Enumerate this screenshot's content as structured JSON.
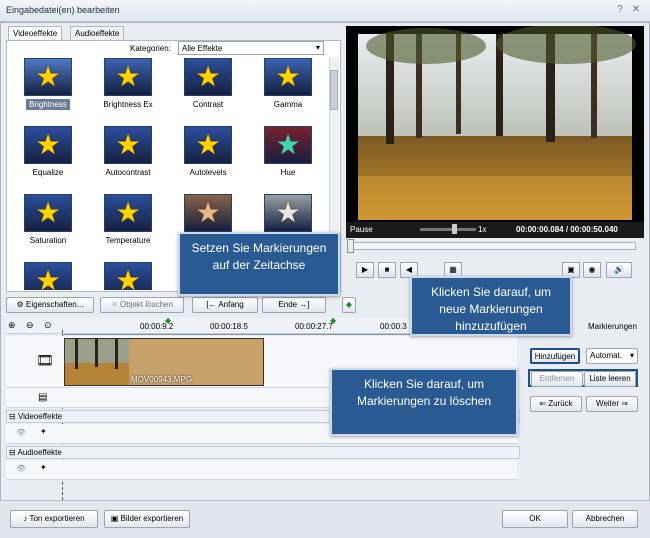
{
  "window": {
    "title": "Eingabedatei(en) bearbeiten"
  },
  "tabs": [
    "Videoeffekte",
    "Audioeffekte"
  ],
  "categories": {
    "label": "Kategorien:",
    "value": "Alle Effekte"
  },
  "effects": [
    {
      "label": "Brightness",
      "color": "#4f7ac9"
    },
    {
      "label": "Brightness Ex",
      "color": "#3b62b3"
    },
    {
      "label": "Contrast",
      "color": "#2c4f9e"
    },
    {
      "label": "Gamma",
      "color": "#3b62b3"
    },
    {
      "label": "Equalize",
      "color": "#2c4f9e"
    },
    {
      "label": "Autocontrast",
      "color": "#2c4f9e"
    },
    {
      "label": "Autolevels",
      "color": "#2c4f9e"
    },
    {
      "label": "Hue",
      "color": "#7a1f2f"
    },
    {
      "label": "Saturation",
      "color": "#2c4f9e"
    },
    {
      "label": "Temperature",
      "color": "#2c4f9e"
    },
    {
      "label": "",
      "color": "#8a6248"
    },
    {
      "label": "",
      "color": "#9aa0a6"
    },
    {
      "label": "",
      "color": "#2c4f9e"
    },
    {
      "label": "",
      "color": "#2c4f9e"
    }
  ],
  "player": {
    "status": "Pause",
    "speed": "1x",
    "time": "00:00:00.084 / 00:00:50.040"
  },
  "toolbar": {
    "properties": "Eigenschaften...",
    "delete_object": "Objekt löschen",
    "start": "Anfang",
    "end": "Ende"
  },
  "timeline": {
    "ticks": [
      "00:00:9.2",
      "00:00:18.5",
      "00:00:27.7",
      "00:00:3"
    ],
    "clip_name": "MOV00943.MPG",
    "video_effects": "Videoeffekte",
    "audio_effects": "Audioeffekte"
  },
  "markers": {
    "header": "Markierungen",
    "add": "Hinzufügen",
    "mode": "Automat.",
    "remove": "Entfernen",
    "clear": "Liste leeren",
    "back": "Zurück",
    "next": "Weiter"
  },
  "callouts": {
    "timeline": "Setzen Sie Markierungen auf der Zeitachse",
    "add": "Klicken Sie darauf, um neue Markierungen hinzuzufügen",
    "remove": "Klicken Sie darauf, um Markierungen zu löschen"
  },
  "bottom": {
    "export_audio": "Ton exportieren",
    "export_images": "Bilder exportieren",
    "ok": "OK",
    "cancel": "Abbrechen"
  }
}
